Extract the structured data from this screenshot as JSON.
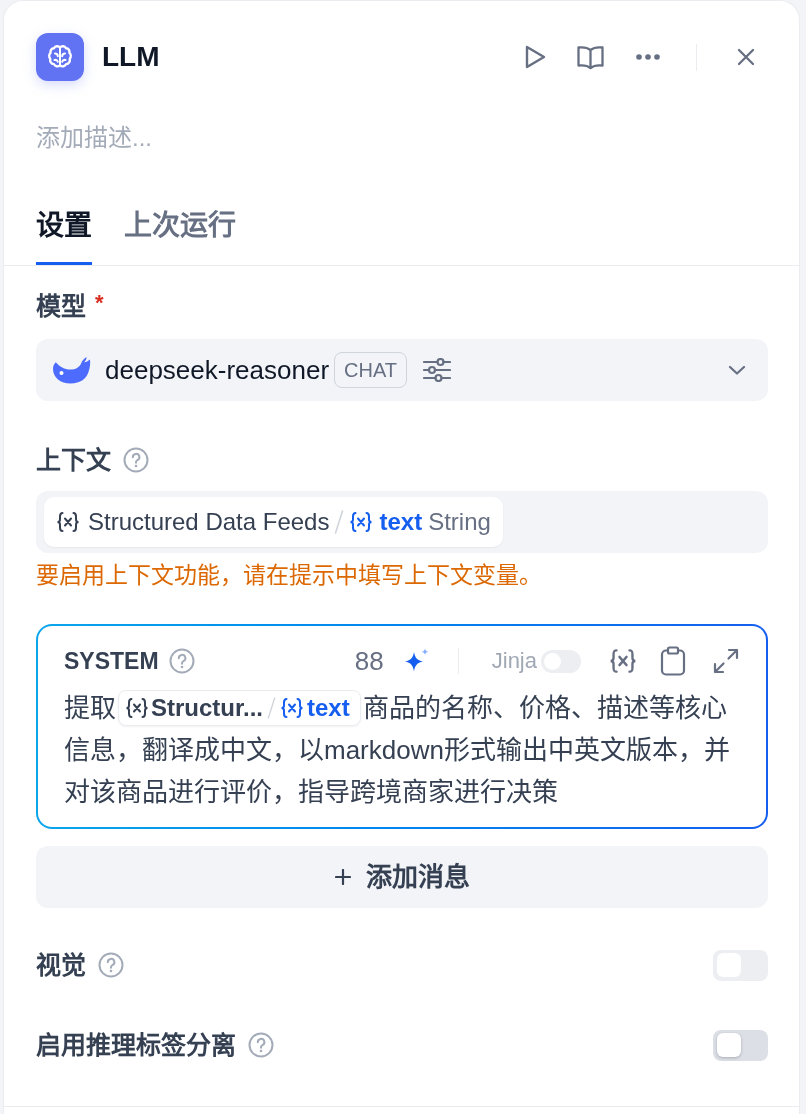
{
  "node": {
    "title": "LLM",
    "description": {
      "placeholder": "添加描述..."
    }
  },
  "tabs": [
    {
      "label": "设置",
      "selected": true
    },
    {
      "label": "上次运行",
      "selected": false
    }
  ],
  "model": {
    "label": "模型",
    "required_mark": "*",
    "name": "deepseek-reasoner",
    "mode": "CHAT"
  },
  "context": {
    "label": "上下文",
    "variable": {
      "node": "Structured Data Feeds",
      "name": "text",
      "type": "String"
    },
    "warning": "要启用上下文功能，请在提示中填写上下文变量。"
  },
  "system_prompt": {
    "role": "SYSTEM",
    "count": "88",
    "focused": true,
    "jinja": {
      "label": "Jinja",
      "on": false,
      "disabled": true
    },
    "lines": [
      [
        {
          "kind": "text",
          "text": "提取"
        },
        {
          "kind": "variable",
          "node": "Structur...",
          "name": "text"
        },
        {
          "kind": "text",
          "text": "商品的名称、价格、描述等核心"
        }
      ],
      [
        {
          "kind": "text",
          "text": "信息，翻译成中文，以markdown形式输出中英文版本，并"
        }
      ],
      [
        {
          "kind": "text",
          "text": "对该商品进行评价，指导跨境商家进行决策"
        }
      ]
    ]
  },
  "add_message": {
    "label": "添加消息"
  },
  "switches": [
    {
      "label": "视觉",
      "on": false,
      "disabled": true
    },
    {
      "label": "启用推理标签分离",
      "on": false,
      "disabled": false
    }
  ]
}
